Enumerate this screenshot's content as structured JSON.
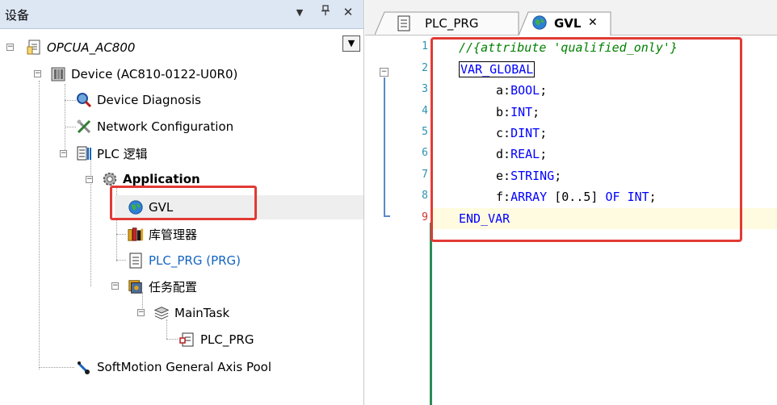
{
  "panel": {
    "title": "设备",
    "pin": "ᵠ",
    "close": "✕",
    "menu": "▼",
    "dropdown": "▼"
  },
  "tree": {
    "root": "OPCUA_AC800",
    "device": "Device (AC810-0122-U0R0)",
    "device_diagnosis": "Device Diagnosis",
    "network_config": "Network Configuration",
    "plc_logic": "PLC 逻辑",
    "application": "Application",
    "gvl": "GVL",
    "library_manager": "库管理器",
    "plc_prg": "PLC_PRG (PRG)",
    "task_config": "任务配置",
    "main_task": "MainTask",
    "task_prg": "PLC_PRG",
    "softmotion": "SoftMotion General Axis Pool"
  },
  "tabs": {
    "plc_prg": "PLC_PRG",
    "gvl": "GVL",
    "close": "✕"
  },
  "code": {
    "line_numbers": [
      "1",
      "2",
      "3",
      "4",
      "5",
      "6",
      "7",
      "8",
      "9"
    ],
    "l1": "//{attribute 'qualified_only'}",
    "l2": "VAR_GLOBAL",
    "l3_name": "a:",
    "l3_type": "BOOL",
    "l3_end": ";",
    "l4_name": "b:",
    "l4_type": "INT",
    "l4_end": ";",
    "l5_name": "c:",
    "l5_type": "DINT",
    "l5_end": ";",
    "l6_name": "d:",
    "l6_type": "REAL",
    "l6_end": ";",
    "l7_name": "e:",
    "l7_type": "STRING",
    "l7_end": ";",
    "l8_name": "f:",
    "l8_array": "ARRAY",
    "l8_range": "[0..5]",
    "l8_of": "OF",
    "l8_int": "INT",
    "l8_end": ";",
    "l9": "END_VAR"
  },
  "colors": {
    "keyword": "#0000ff",
    "comment": "#008000",
    "highlight_border": "#e23a35",
    "line_number": "#2b91af"
  }
}
